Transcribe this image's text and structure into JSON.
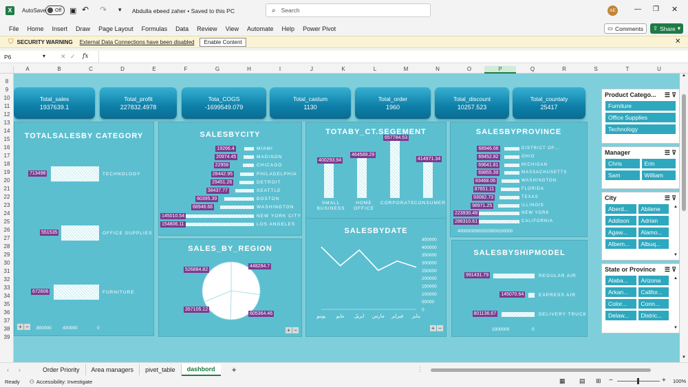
{
  "titlebar": {
    "autosave": "AutoSave",
    "toggle": "Off",
    "doc_title": "Abdulla ebeed zaher • Saved to this PC",
    "search_placeholder": "Search",
    "avatar": "AE"
  },
  "ribbon": {
    "tabs": [
      "File",
      "Home",
      "Insert",
      "Draw",
      "Page Layout",
      "Formulas",
      "Data",
      "Review",
      "View",
      "Automate",
      "Help",
      "Power Pivot"
    ],
    "comments": "Comments",
    "share": "Share"
  },
  "security": {
    "title": "SECURITY WARNING",
    "message": "External Data Connections have been disabled",
    "button": "Enable Content"
  },
  "formula": {
    "namebox": "P6",
    "fx": "fx",
    "value": ""
  },
  "columns": [
    "A",
    "B",
    "C",
    "D",
    "E",
    "F",
    "G",
    "H",
    "I",
    "J",
    "K",
    "L",
    "M",
    "N",
    "O",
    "P",
    "Q",
    "R",
    "S",
    "T",
    "U"
  ],
  "rows": [
    "8",
    "9",
    "10",
    "11",
    "12",
    "13",
    "14",
    "15",
    "16",
    "17",
    "18",
    "19",
    "20",
    "21",
    "22",
    "23",
    "24",
    "25",
    "26",
    "27",
    "28",
    "29",
    "30",
    "31",
    "32",
    "33",
    "34",
    "35",
    "36",
    "37",
    "38",
    "39"
  ],
  "kpis": [
    {
      "label": "Total_sales",
      "value": "1937639.1"
    },
    {
      "label": "Total_profit",
      "value": "227832.4978"
    },
    {
      "label": "Tota_COGS",
      "value": "-1699549.079"
    },
    {
      "label": "Total_castum",
      "value": "1130"
    },
    {
      "label": "Total_order",
      "value": "1960"
    },
    {
      "label": "Total_discount",
      "value": "10257.523"
    },
    {
      "label": "Total_countaty",
      "value": "25417"
    }
  ],
  "charts": {
    "category": {
      "title": "TOTALSALESBY CATEGORY",
      "categories": [
        "TECHNOLOGY",
        "OFFICE SUPPLIES",
        "FURNITURE"
      ],
      "labels": [
        "713498",
        "551535",
        "672606"
      ],
      "values": [
        713498,
        551535,
        672606
      ],
      "ticks": [
        "800000",
        "400000",
        "0"
      ]
    },
    "city": {
      "title": "SALESBYCITY",
      "categories": [
        "MIAMI",
        "MADISON",
        "CHICAGO",
        "PHILADELPHIA",
        "DETROIT",
        "SEATTLE",
        "BOSTON",
        "WASHINGTON",
        "NEW YORK CITY",
        "LOS ANGELES"
      ],
      "labels": [
        "19266.4",
        "20974.45",
        "22958",
        "28442.95",
        "29451.26",
        "38437.77",
        "60395.39",
        "68946.66",
        "145010.54",
        "154806.11"
      ],
      "values": [
        19266.4,
        20974.45,
        22958,
        28442.95,
        29451.26,
        38437.77,
        60395.39,
        68946.66,
        145010.54,
        154806.11
      ]
    },
    "segment": {
      "title": "TOTABY_CT.SEGEMENT",
      "categories": [
        "SMALL BUSINESS",
        "HOME OFFICE",
        "CORPORATE",
        "CONSUMER"
      ],
      "labels": [
        "400293.94",
        "464589.29",
        "657784.53",
        "414971.34"
      ],
      "values": [
        400293.94,
        464589.29,
        657784.53,
        414971.34
      ]
    },
    "province": {
      "title": "SALESBYPROVINCE",
      "categories": [
        "DISTRICT OF...",
        "OHIO",
        "MICHIGAN",
        "MASSACHUSETTS",
        "WASHINGTON",
        "FLORIDA",
        "TEXAS",
        "ILLINOIS",
        "NEW YORK",
        "CALIFORNIA"
      ],
      "labels": [
        "68946.66",
        "69452.82",
        "69641.81",
        "69855.39",
        "83468.06",
        "87651.11",
        "93082.73",
        "98971.25",
        "223930.48",
        "288310.61"
      ],
      "values": [
        68946.66,
        69452.82,
        69641.81,
        69855.39,
        83468.06,
        87651.11,
        93082.73,
        98971.25,
        223930.48,
        288310.61
      ],
      "ticks": "400000300000200000100000"
    },
    "region": {
      "title": "SALES_BY_REGION",
      "labels": [
        "526884.82",
        "448284.7",
        "357105.12",
        "605364.46"
      ],
      "values": [
        526884.82,
        448284.7,
        357105.12,
        605364.46
      ]
    },
    "date": {
      "title": "SALESBYDATE",
      "categories": [
        "يناير",
        "فبراير",
        "مارس",
        "ابريل",
        "مايو",
        "يونيو"
      ],
      "values": [
        270000,
        310000,
        250000,
        380000,
        280000,
        400000
      ],
      "yticks": [
        "450000",
        "400000",
        "350000",
        "300000",
        "250000",
        "200000",
        "150000",
        "100000",
        "50000",
        "0"
      ],
      "ylim": [
        0,
        450000
      ]
    },
    "shipmodel": {
      "title": "SALESBYSHIPMODEL",
      "categories": [
        "REGULAR AIR",
        "EXPRESS AIR",
        "DELIVERY TRUCK"
      ],
      "labels": [
        "991431.79",
        "145070.64",
        "801136.67"
      ],
      "values": [
        991431.79,
        145070.64,
        801136.67
      ],
      "ticks": [
        "1000000",
        "0"
      ]
    }
  },
  "slicers": [
    {
      "title": "Product Catego...",
      "items": [
        "Furniture",
        "Office Supplies",
        "Technology"
      ]
    },
    {
      "title": "Manager",
      "items": [
        "Chris",
        "Erin",
        "Sam",
        "William"
      ]
    },
    {
      "title": "City",
      "items": [
        "Aberd...",
        "Abilene",
        "Addison",
        "Adrian",
        "Agaw...",
        "Alamo...",
        "Albem...",
        "Albuq..."
      ]
    },
    {
      "title": "State or Province",
      "items": [
        "Alaba...",
        "Arizona",
        "Arkan...",
        "Califor...",
        "Color...",
        "Conn...",
        "Delaw...",
        "Distric..."
      ]
    }
  ],
  "sheettabs": [
    "Order Priority",
    "Area managers",
    "pivet_table",
    "dashbord"
  ],
  "status": {
    "ready": "Ready",
    "accessibility": "Accessibility: Investigate",
    "zoom": "100%"
  },
  "colors": {
    "accent": "#1f7a45",
    "panel": "#5cbfd0",
    "label": "#7c3a8f"
  }
}
